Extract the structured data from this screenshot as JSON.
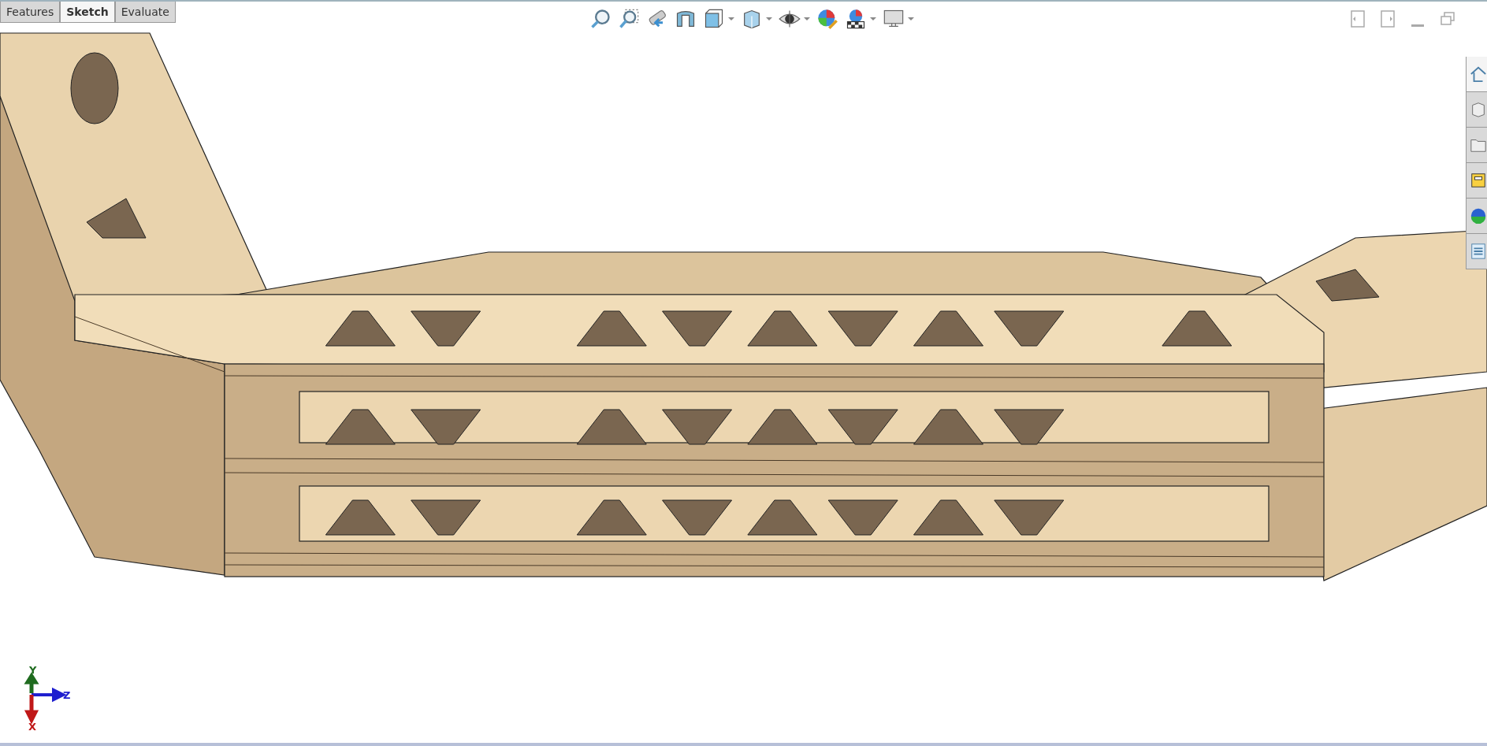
{
  "tabs": [
    {
      "label": "Features",
      "selected": false
    },
    {
      "label": "Sketch",
      "selected": true
    },
    {
      "label": "Evaluate",
      "selected": false
    }
  ],
  "triad": {
    "axes": [
      {
        "label": "Y",
        "color": "#1f6b1f"
      },
      {
        "label": "Z",
        "color": "#1f1fcf"
      },
      {
        "label": "X",
        "color": "#c01818"
      }
    ]
  }
}
